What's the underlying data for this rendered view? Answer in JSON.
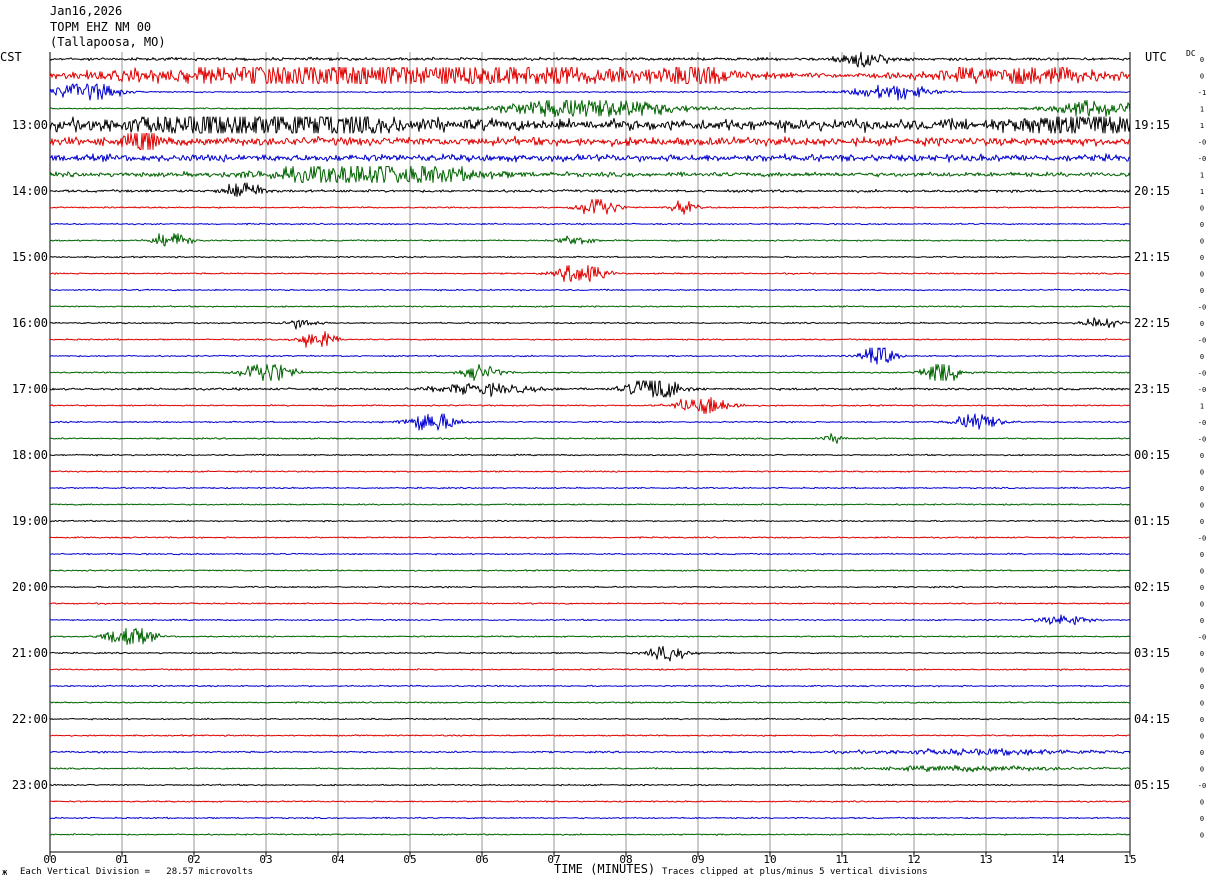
{
  "header": {
    "date": "Jan16,2026",
    "station": "TOPM EHZ NM 00",
    "location": "(Tallapoosa, MO)"
  },
  "left_axis_title": "CST",
  "right_axis_title": "UTC",
  "dc_label": "DC",
  "footer": {
    "scale_note": "Each Vertical Division =   28.57 microvolts",
    "x_axis_title": "TIME (MINUTES)",
    "clip_note": "Traces clipped at plus/minus 5 vertical divisions",
    "corner_mark": "ж"
  },
  "colors": {
    "black": "#000000",
    "red": "#e00000",
    "blue": "#0000d0",
    "green": "#006400",
    "grid": "#999999"
  },
  "chart_data": {
    "type": "line",
    "title": "TOPM EHZ NM 00",
    "xlabel": "TIME (MINUTES)",
    "xlim": [
      0,
      15
    ],
    "x_ticks": [
      "00",
      "01",
      "02",
      "03",
      "04",
      "05",
      "06",
      "07",
      "08",
      "09",
      "10",
      "11",
      "12",
      "13",
      "14",
      "15"
    ],
    "left_time_labels": [
      "13:00",
      "14:00",
      "15:00",
      "16:00",
      "17:00",
      "18:00",
      "19:00",
      "20:00",
      "21:00",
      "22:00",
      "23:00"
    ],
    "right_time_labels": [
      "19:15",
      "20:15",
      "21:15",
      "22:15",
      "23:15",
      "00:15",
      "01:15",
      "02:15",
      "03:15",
      "04:15",
      "05:15"
    ],
    "trace_colors_cycle": [
      "black",
      "red",
      "blue",
      "green"
    ],
    "trace_count": 48,
    "first_labeled_trace": 4,
    "traces_per_hour": 4,
    "dc_offsets": [
      "0",
      "0",
      "-1",
      "1",
      "1",
      "-0",
      "-0",
      "1",
      "1",
      "0",
      "0",
      "0",
      "0",
      "0",
      "0",
      "-0",
      "0",
      "-0",
      "0",
      "-0",
      "-0",
      "1",
      "-0",
      "-0",
      "0",
      "0",
      "0",
      "0",
      "0",
      "-0",
      "0",
      "0",
      "0",
      "0",
      "0",
      "-0",
      "0",
      "0",
      "0",
      "0",
      "0",
      "0",
      "0",
      "0",
      "-0",
      "0",
      "0",
      "0"
    ],
    "noise_level": [
      1,
      0.9,
      0.5,
      0.5,
      4,
      3,
      2.5,
      1.6,
      0.9,
      0.5,
      0.5,
      0.5,
      0.5,
      0.5,
      0.5,
      0.5,
      0.5,
      0.5,
      0.5,
      0.5,
      0.8,
      0.5,
      0.5,
      0.5,
      0.5,
      0.5,
      0.5,
      0.5,
      0.5,
      0.5,
      0.5,
      0.5,
      0.5,
      0.5,
      0.5,
      0.5,
      0.5,
      0.5,
      0.5,
      0.5,
      0.5,
      0.5,
      0.6,
      0.5,
      0.5,
      0.5,
      0.5,
      0.5
    ],
    "events": [
      {
        "trace": 0,
        "minute": 11.3,
        "width": 0.4,
        "amp": 6
      },
      {
        "trace": 1,
        "minute": 3.3,
        "width": 3.0,
        "amp": 8
      },
      {
        "trace": 1,
        "minute": 6.5,
        "width": 3.5,
        "amp": 8
      },
      {
        "trace": 1,
        "minute": 9.0,
        "width": 0.3,
        "amp": 14
      },
      {
        "trace": 1,
        "minute": 13.5,
        "width": 1.5,
        "amp": 8
      },
      {
        "trace": 2,
        "minute": 0.5,
        "width": 0.5,
        "amp": 8
      },
      {
        "trace": 2,
        "minute": 11.7,
        "width": 0.6,
        "amp": 6
      },
      {
        "trace": 3,
        "minute": 7.5,
        "width": 1.4,
        "amp": 9
      },
      {
        "trace": 3,
        "minute": 14.5,
        "width": 0.7,
        "amp": 7
      },
      {
        "trace": 4,
        "minute": 3.0,
        "width": 2.0,
        "amp": 10
      },
      {
        "trace": 4,
        "minute": 14.5,
        "width": 1.0,
        "amp": 10
      },
      {
        "trace": 5,
        "minute": 1.3,
        "width": 0.2,
        "amp": 14
      },
      {
        "trace": 7,
        "minute": 4.5,
        "width": 1.5,
        "amp": 10
      },
      {
        "trace": 8,
        "minute": 2.7,
        "width": 0.3,
        "amp": 8
      },
      {
        "trace": 9,
        "minute": 7.6,
        "width": 0.3,
        "amp": 10
      },
      {
        "trace": 9,
        "minute": 8.8,
        "width": 0.2,
        "amp": 5
      },
      {
        "trace": 11,
        "minute": 1.7,
        "width": 0.3,
        "amp": 6
      },
      {
        "trace": 11,
        "minute": 7.3,
        "width": 0.3,
        "amp": 4
      },
      {
        "trace": 13,
        "minute": 7.4,
        "width": 0.35,
        "amp": 10
      },
      {
        "trace": 16,
        "minute": 3.5,
        "width": 0.25,
        "amp": 4
      },
      {
        "trace": 16,
        "minute": 14.6,
        "width": 0.25,
        "amp": 5
      },
      {
        "trace": 17,
        "minute": 3.7,
        "width": 0.25,
        "amp": 10
      },
      {
        "trace": 18,
        "minute": 11.5,
        "width": 0.25,
        "amp": 10
      },
      {
        "trace": 19,
        "minute": 3.0,
        "width": 0.4,
        "amp": 10
      },
      {
        "trace": 19,
        "minute": 6.0,
        "width": 0.3,
        "amp": 6
      },
      {
        "trace": 19,
        "minute": 12.4,
        "width": 0.3,
        "amp": 12
      },
      {
        "trace": 20,
        "minute": 8.4,
        "width": 0.4,
        "amp": 12
      },
      {
        "trace": 20,
        "minute": 6.0,
        "width": 0.8,
        "amp": 4
      },
      {
        "trace": 21,
        "minute": 9.1,
        "width": 0.45,
        "amp": 8
      },
      {
        "trace": 22,
        "minute": 5.3,
        "width": 0.4,
        "amp": 9
      },
      {
        "trace": 22,
        "minute": 12.9,
        "width": 0.35,
        "amp": 8
      },
      {
        "trace": 23,
        "minute": 10.9,
        "width": 0.2,
        "amp": 3
      },
      {
        "trace": 35,
        "minute": 1.1,
        "width": 0.35,
        "amp": 10
      },
      {
        "trace": 34,
        "minute": 14.1,
        "width": 0.4,
        "amp": 4
      },
      {
        "trace": 36,
        "minute": 8.6,
        "width": 0.35,
        "amp": 5
      },
      {
        "trace": 42,
        "minute": 13.0,
        "width": 2.0,
        "amp": 2
      },
      {
        "trace": 43,
        "minute": 12.8,
        "width": 1.5,
        "amp": 2
      }
    ]
  }
}
